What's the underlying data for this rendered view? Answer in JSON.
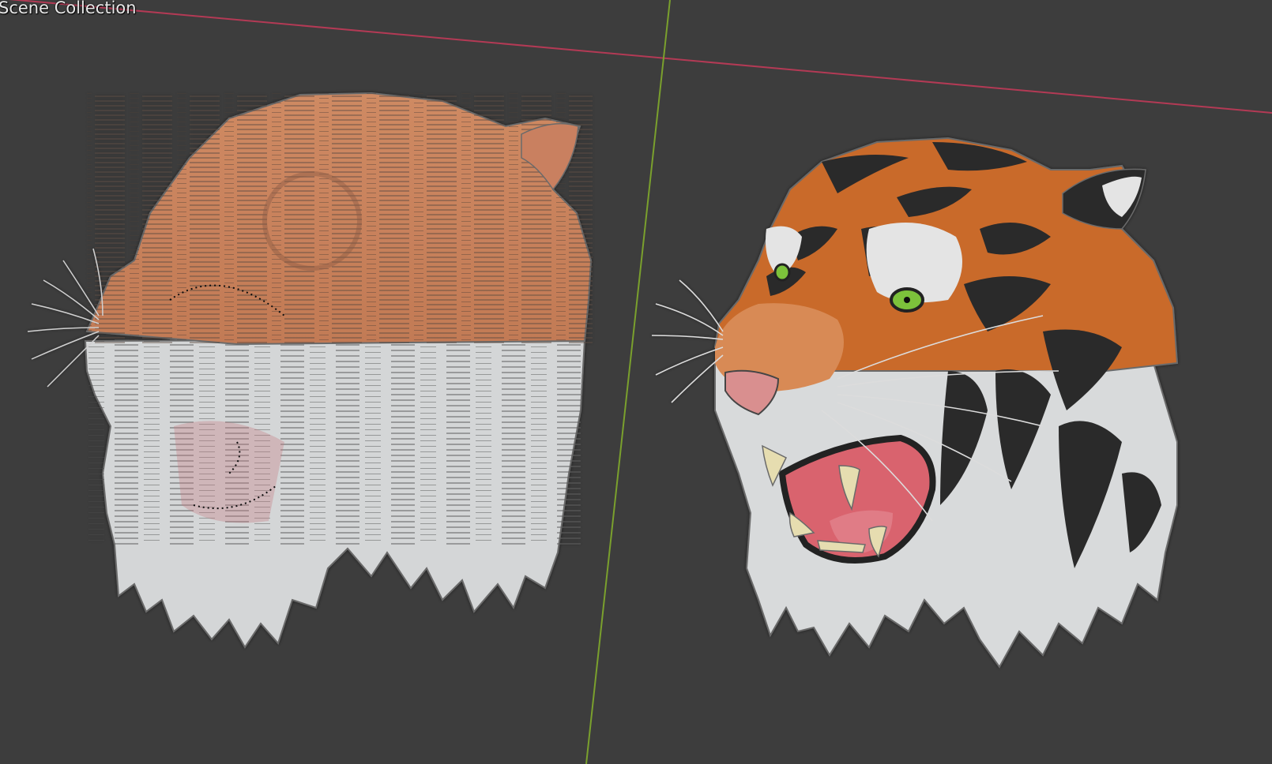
{
  "viewport": {
    "collection_label": "Scene Collection",
    "background_color": "#3d3d3d",
    "x_axis_color": "#b33a55",
    "y_axis_color": "#7aa02d"
  },
  "objects": [
    {
      "name": "tiger-head-broken-mesh",
      "shading": "z-fighting / overlapping faces"
    },
    {
      "name": "tiger-head-correct-mesh",
      "shading": "clean layered faces"
    }
  ],
  "colors": {
    "fur_orange": "#c96a2a",
    "fur_orange_light": "#d88a55",
    "fur_white": "#d8dadb",
    "stripe_black": "#2a2a2a",
    "eye_green": "#7bc23b",
    "mouth_pink": "#d9636e",
    "nose_pink": "#d98f8f",
    "tooth_cream": "#e6ddb0",
    "outline": "#6a6a6a"
  }
}
